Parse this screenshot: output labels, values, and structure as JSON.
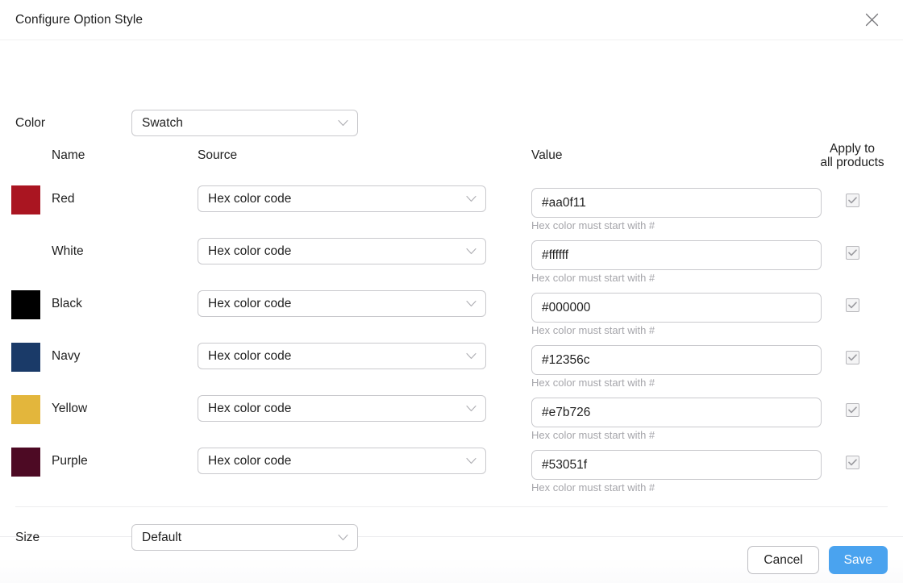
{
  "dialog": {
    "title": "Configure Option Style",
    "close_icon": "close-icon"
  },
  "attributes": {
    "color": {
      "label": "Color",
      "style_value": "Swatch"
    },
    "size": {
      "label": "Size",
      "style_value": "Default"
    }
  },
  "columns": {
    "name": "Name",
    "source": "Source",
    "value": "Value",
    "apply_line1": "Apply to",
    "apply_line2": "all products"
  },
  "hint_text": "Hex color must start with #",
  "options": [
    {
      "name": "Red",
      "source": "Hex color code",
      "value": "#aa0f11",
      "swatch": "#aa1521",
      "hint": "Hex color must start with #",
      "apply_all": true
    },
    {
      "name": "White",
      "source": "Hex color code",
      "value": "#ffffff",
      "swatch": "#ffffff",
      "hint": "Hex color must start with #",
      "apply_all": true
    },
    {
      "name": "Black",
      "source": "Hex color code",
      "value": "#000000",
      "swatch": "#000000",
      "hint": "Hex color must start with #",
      "apply_all": true
    },
    {
      "name": "Navy",
      "source": "Hex color code",
      "value": "#12356c",
      "swatch": "#1a3a68",
      "hint": "Hex color must start with #",
      "apply_all": true
    },
    {
      "name": "Yellow",
      "source": "Hex color code",
      "value": "#e7b726",
      "swatch": "#e3b63c",
      "hint": "Hex color must start with #",
      "apply_all": true
    },
    {
      "name": "Purple",
      "source": "Hex color code",
      "value": "#53051f",
      "swatch": "#4d0a24",
      "hint": "Hex color must start with #",
      "apply_all": true
    }
  ],
  "footer": {
    "cancel_label": "Cancel",
    "save_label": "Save",
    "save_color": "#4aa3ef"
  }
}
